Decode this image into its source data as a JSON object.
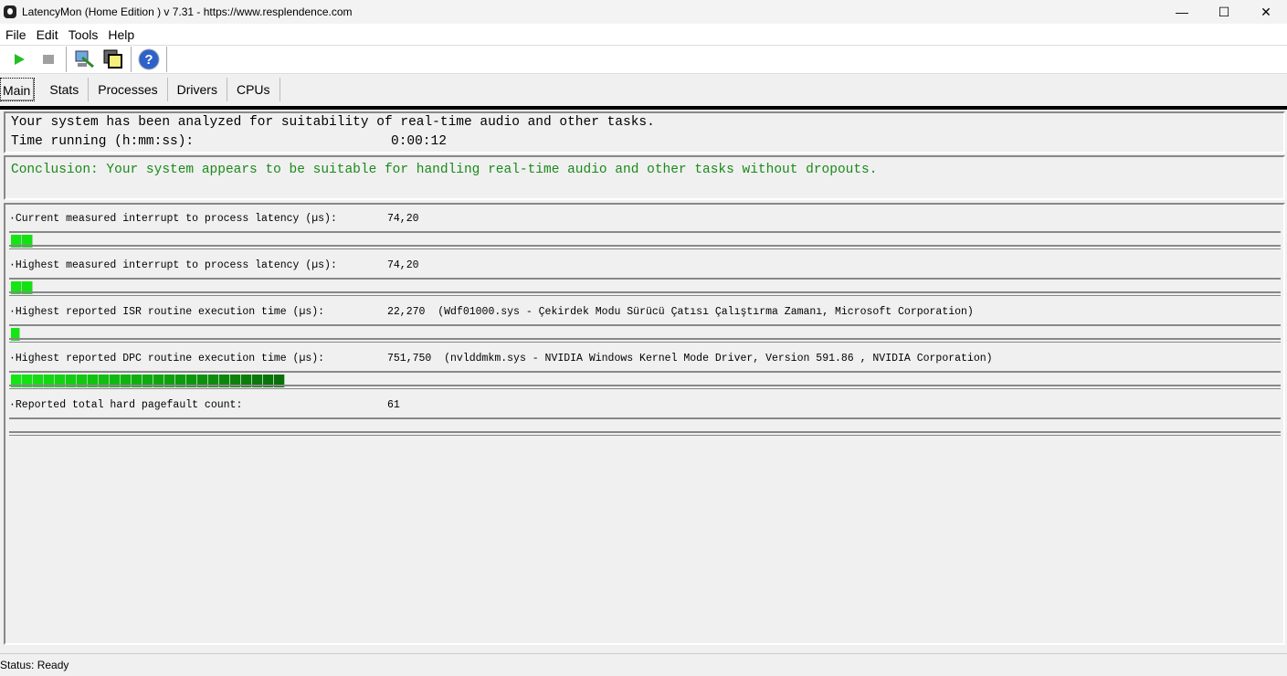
{
  "window": {
    "title": "LatencyMon  (Home Edition )  v 7.31 - https://www.resplendence.com",
    "minimize": "—",
    "maximize": "☐",
    "close": "✕"
  },
  "menu": [
    "File",
    "Edit",
    "Tools",
    "Help"
  ],
  "toolbar": {
    "icons": [
      "play-icon",
      "stop-icon",
      "report-icon",
      "windows-icon",
      "help-icon"
    ],
    "play_color": "#22c022"
  },
  "tabs": [
    "Main",
    "Stats",
    "Processes",
    "Drivers",
    "CPUs"
  ],
  "active_tab": "Main",
  "summary": {
    "line1": "Your system has been analyzed for suitability of real-time audio and other tasks.",
    "time_label": "Time running (h:mm:ss):",
    "time_value": "0:00:12"
  },
  "conclusion": {
    "text": "Conclusion: Your system appears to be suitable for handling real-time audio and other tasks without dropouts.",
    "color": "#1a8a1a"
  },
  "metrics": [
    {
      "label": "·Current measured interrupt to process latency (µs):",
      "value": "74,20",
      "detail": "",
      "bar_segments": 2
    },
    {
      "label": "·Highest measured interrupt to process latency (µs):",
      "value": "74,20",
      "detail": "",
      "bar_segments": 2
    },
    {
      "label": "·Highest reported ISR routine execution time (µs):",
      "value": "22,270",
      "detail": "(Wdf01000.sys - Çekirdek Modu Sürücü Çatısı Çalıştırma Zamanı, Microsoft Corporation)",
      "bar_segments": 1
    },
    {
      "label": "·Highest reported DPC routine execution time (µs):",
      "value": "751,750",
      "detail": "(nvlddmkm.sys - NVIDIA Windows Kernel Mode Driver, Version 591.86 , NVIDIA Corporation)",
      "bar_segments": 25
    },
    {
      "label": "·Reported total hard pagefault count:",
      "value": "61",
      "detail": "",
      "bar_segments": 0
    }
  ],
  "status": "Status: Ready"
}
